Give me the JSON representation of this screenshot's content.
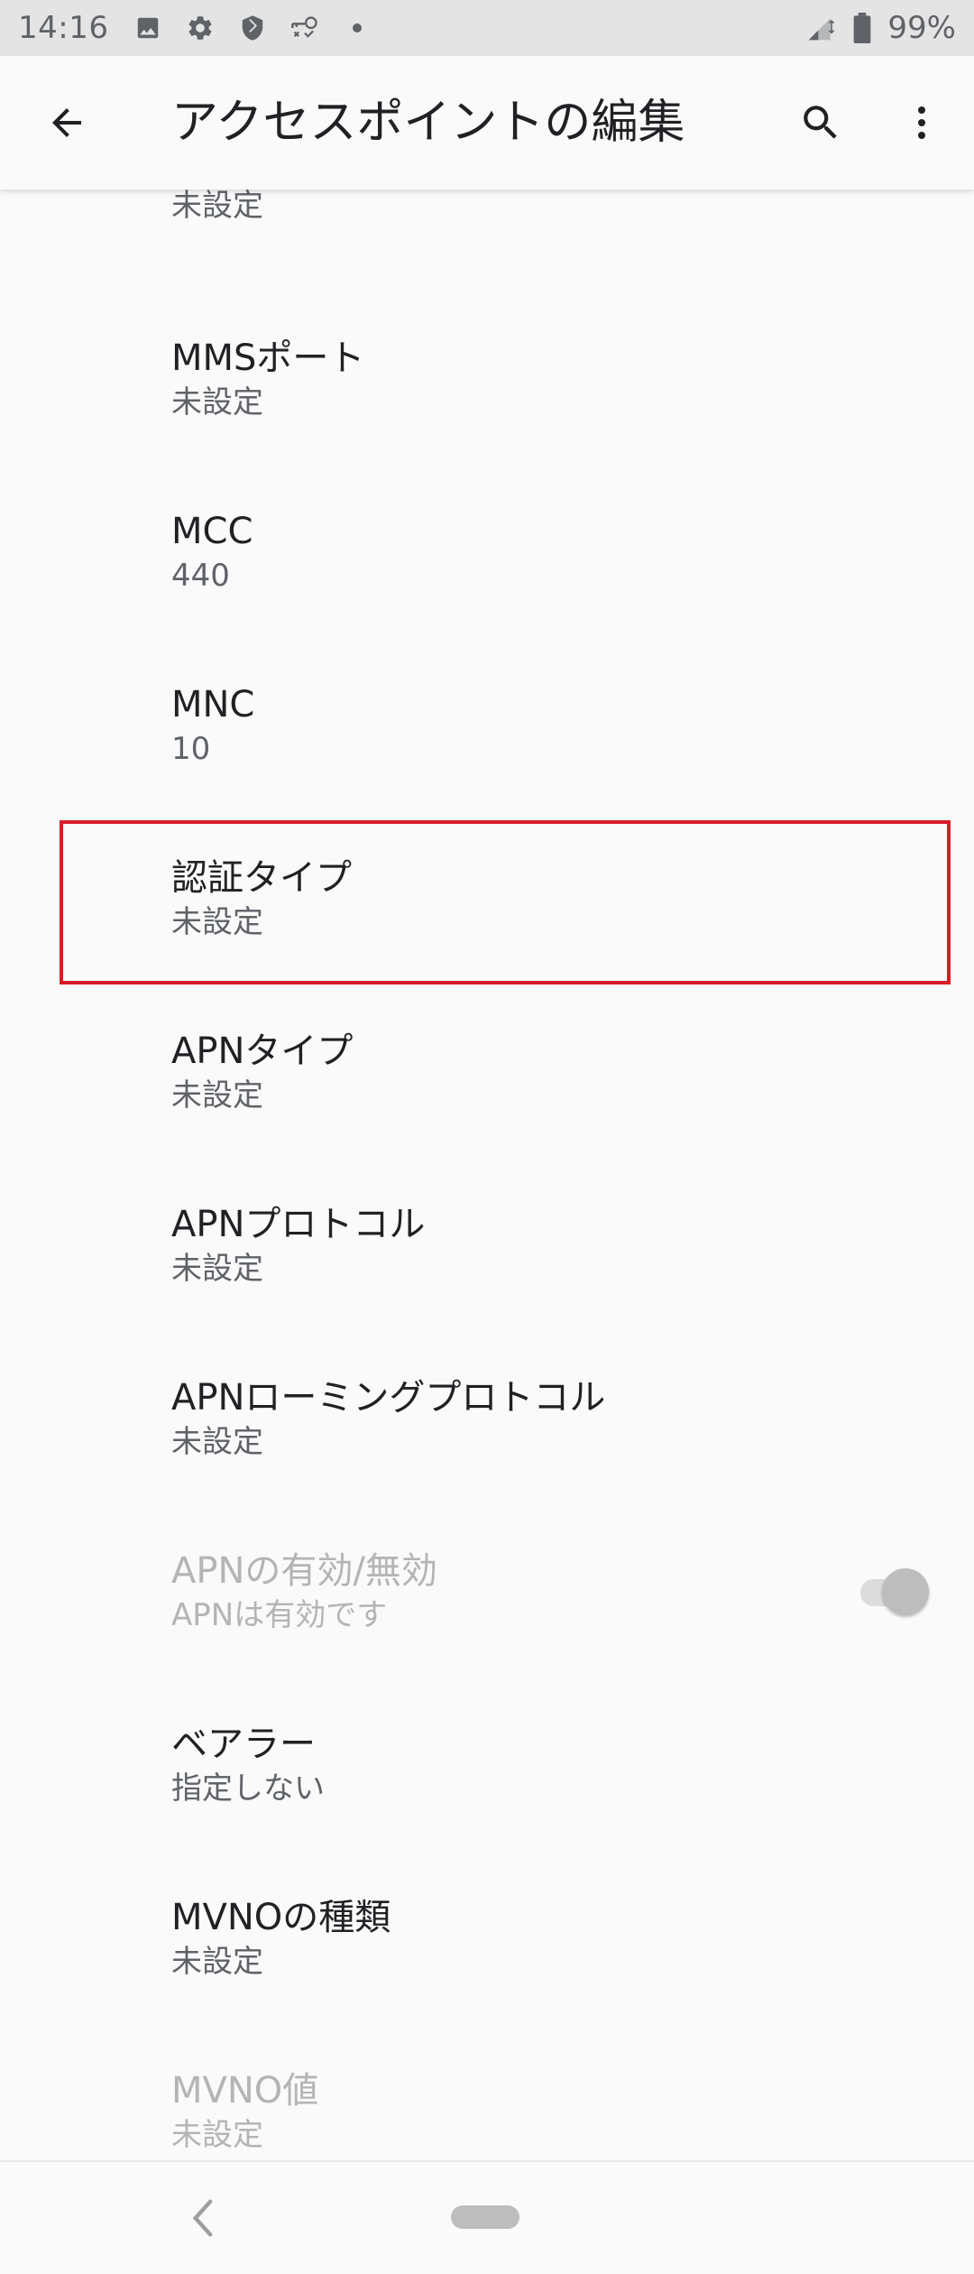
{
  "status_bar": {
    "time": "14:16",
    "left_icons": [
      "gallery-icon",
      "settings-gear-icon",
      "shield-icon",
      "vpn-key-icon",
      "dot-icon"
    ],
    "right_icons": [
      "signal-icon",
      "battery-icon"
    ],
    "battery": "99%"
  },
  "app_bar": {
    "title": "アクセスポイントの編集",
    "back_icon": "arrow-back-icon",
    "search_icon": "search-icon",
    "more_icon": "more-vert-icon"
  },
  "list": {
    "items": [
      {
        "title": "",
        "summary": "未設定",
        "disabled": false
      },
      {
        "title": "MMSポート",
        "summary": "未設定",
        "disabled": false
      },
      {
        "title": "MCC",
        "summary": "440",
        "disabled": false
      },
      {
        "title": "MNC",
        "summary": "10",
        "disabled": false
      },
      {
        "title": "認証タイプ",
        "summary": "未設定",
        "disabled": false,
        "highlighted": true
      },
      {
        "title": "APNタイプ",
        "summary": "未設定",
        "disabled": false
      },
      {
        "title": "APNプロトコル",
        "summary": "未設定",
        "disabled": false
      },
      {
        "title": "APNローミングプロトコル",
        "summary": "未設定",
        "disabled": false
      },
      {
        "title": "APNの有効/無効",
        "summary": "APNは有効です",
        "disabled": true,
        "switch_on": true
      },
      {
        "title": "ベアラー",
        "summary": "指定しない",
        "disabled": false
      },
      {
        "title": "MVNOの種類",
        "summary": "未設定",
        "disabled": false
      },
      {
        "title": "MVNO値",
        "summary": "未設定",
        "disabled": true
      }
    ]
  },
  "nav_bar": {
    "back_icon": "nav-back-icon",
    "home_icon": "nav-home-pill-icon"
  },
  "colors": {
    "status_bar_bg": "#e4e4e4",
    "background": "#fafafa",
    "highlight_border": "#d71e28",
    "disabled_text": "#b4b4b4"
  }
}
